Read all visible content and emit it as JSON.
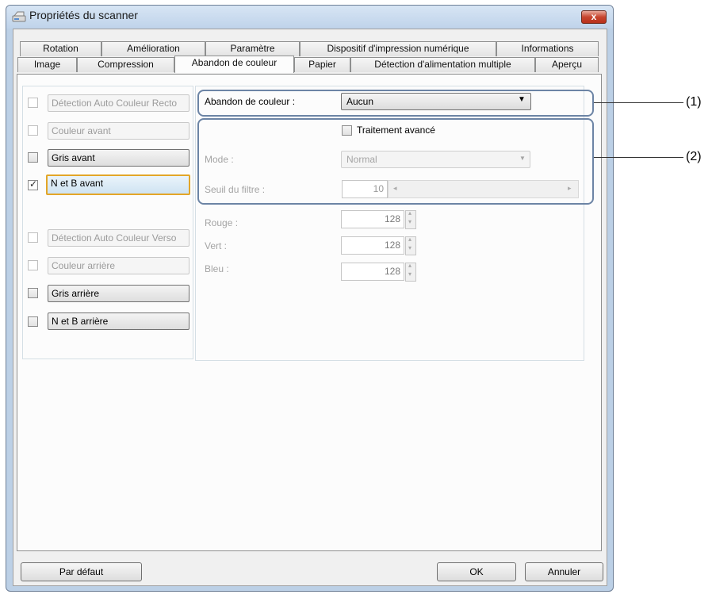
{
  "window": {
    "title": "Propriétés du scanner",
    "close_label": "x"
  },
  "tabs_row1": [
    "Rotation",
    "Amélioration",
    "Paramètre",
    "Dispositif d'impression numérique",
    "Informations"
  ],
  "tabs_row2": [
    "Image",
    "Compression",
    "Abandon de couleur",
    "Papier",
    "Détection d'alimentation multiple",
    "Aperçu"
  ],
  "left": {
    "items": [
      {
        "label": "Détection Auto Couleur Recto",
        "checked": false
      },
      {
        "label": "Couleur avant",
        "checked": false
      },
      {
        "label": "Gris avant",
        "checked": false
      },
      {
        "label": "N et B avant",
        "checked": true
      },
      {
        "label": "Détection Auto Couleur Verso",
        "checked": false
      },
      {
        "label": "Couleur arrière",
        "checked": false
      },
      {
        "label": "Gris arrière",
        "checked": false
      },
      {
        "label": "N et B arrière",
        "checked": false
      }
    ]
  },
  "right": {
    "color_drop_label": "Abandon de couleur :",
    "color_drop_value": "Aucun",
    "advanced_label": "Traitement avancé",
    "mode_label": "Mode :",
    "mode_value": "Normal",
    "threshold_label": "Seuil du filtre :",
    "threshold_value": "10",
    "red_label": "Rouge :",
    "red_value": "128",
    "green_label": "Vert :",
    "green_value": "128",
    "blue_label": "Bleu :",
    "blue_value": "128"
  },
  "callouts": {
    "one": "(1)",
    "two": "(2)"
  },
  "buttons": {
    "default": "Par défaut",
    "ok": "OK",
    "cancel": "Annuler"
  }
}
